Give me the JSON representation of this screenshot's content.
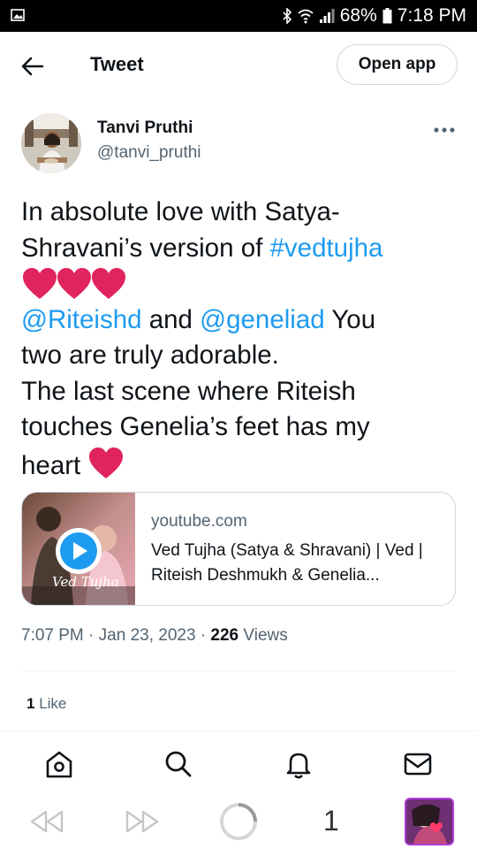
{
  "status_bar": {
    "battery": "68%",
    "time": "7:18 PM"
  },
  "header": {
    "title": "Tweet",
    "open_app_label": "Open app"
  },
  "tweet": {
    "author_name": "Tanvi Pruthi",
    "author_handle": "@tanvi_pruthi",
    "text": {
      "line1": "In absolute love with Satya-",
      "line2_a": "Shravani’s version of ",
      "line2_hashtag": "#vedtujha",
      "line4_mention1": "@Riteishd",
      "line4_and": " and ",
      "line4_mention2": "@geneliad",
      "line4_tail": " You",
      "line5": "two are truly adorable.",
      "line6": "The last scene where Riteish",
      "line7": "touches Genelia’s feet has my",
      "line8": "heart "
    },
    "card": {
      "thumb_caption": "Ved Tujha",
      "domain": "youtube.com",
      "title": "Ved Tujha (Satya & Shravani) | Ved | Riteish Deshmukh & Genelia..."
    },
    "time": "7:07 PM",
    "date": "Jan 23, 2023",
    "views_count": "226",
    "views_label": " Views",
    "likes_count": "1",
    "likes_label": " Like"
  },
  "browser_bar": {
    "tab_count": "1"
  },
  "colors": {
    "accent": "#1d9bf0",
    "heart": "#e0245e",
    "text": "#0f1419",
    "muted": "#536471"
  },
  "icons": {
    "status_left": "gallery-icon",
    "status_right": [
      "bluetooth-icon",
      "wifi-icon",
      "signal-icon",
      "battery-icon"
    ],
    "nav": [
      "home-icon",
      "search-icon",
      "notifications-icon",
      "messages-icon"
    ],
    "browser": [
      "back-icon",
      "forward-icon",
      "loading-icon"
    ]
  }
}
